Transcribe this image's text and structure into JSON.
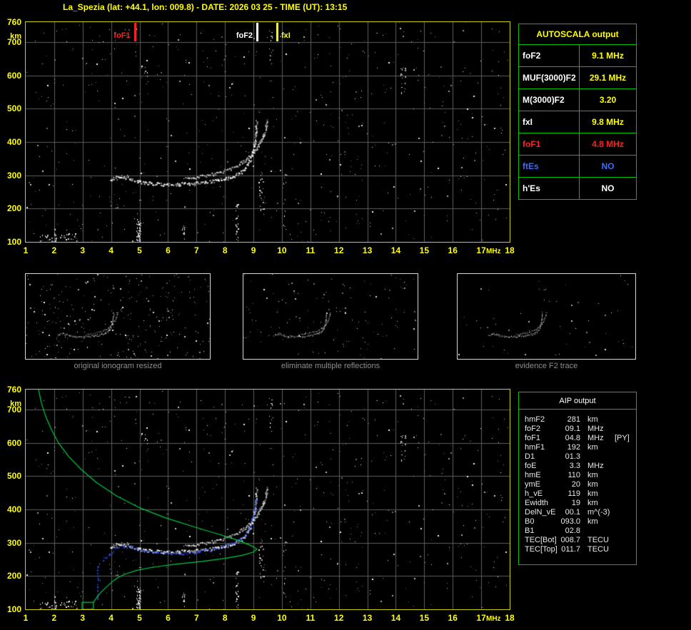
{
  "title": "La_Spezia (lat: +44.1, lon: 009.8) - DATE: 2026 03 25 - TIME (UT): 13:15",
  "colors": {
    "accent_yellow": "#ffff00",
    "plot_border": "#d0d000",
    "table_border": "#00c000",
    "grid": "#5c5c5c",
    "trace_white": "#ffffff",
    "profile_green": "#00cc44",
    "restored_blue": "#3355ff",
    "marker_red": "#ff0000",
    "caption_gray": "#8e8e8e"
  },
  "ionogram": {
    "x_unit": "MHz",
    "y_unit": "km",
    "f_range": [
      1,
      18
    ],
    "h_range": [
      100,
      760
    ],
    "x_ticks": [
      1,
      2,
      3,
      4,
      5,
      6,
      7,
      8,
      9,
      10,
      11,
      12,
      13,
      14,
      15,
      16,
      17,
      18
    ],
    "y_ticks": [
      760,
      700,
      600,
      500,
      400,
      300,
      200,
      100
    ],
    "markers": [
      {
        "label": "foF1",
        "freq": 4.8,
        "color": "#ff2222",
        "side": "left"
      },
      {
        "label": "foF2",
        "freq": 9.1,
        "color": "#ffffff",
        "side": "left"
      },
      {
        "label": "fxI",
        "freq": 9.8,
        "color": "#ffff00",
        "side": "right"
      }
    ],
    "o_trace": [
      [
        3.95,
        287
      ],
      [
        4.2,
        294
      ],
      [
        4.45,
        297
      ],
      [
        4.7,
        291
      ],
      [
        5.0,
        281
      ],
      [
        5.4,
        276
      ],
      [
        5.9,
        274
      ],
      [
        6.4,
        275
      ],
      [
        6.9,
        277
      ],
      [
        7.3,
        280
      ],
      [
        7.7,
        285
      ],
      [
        8.0,
        291
      ],
      [
        8.3,
        300
      ],
      [
        8.55,
        312
      ],
      [
        8.72,
        326
      ],
      [
        8.85,
        343
      ],
      [
        8.95,
        366
      ],
      [
        9.02,
        396
      ],
      [
        9.07,
        430
      ],
      [
        9.1,
        462
      ]
    ],
    "x_trace": [
      [
        6.6,
        291
      ],
      [
        7.0,
        296
      ],
      [
        7.4,
        302
      ],
      [
        7.8,
        310
      ],
      [
        8.1,
        318
      ],
      [
        8.4,
        329
      ],
      [
        8.65,
        342
      ],
      [
        8.85,
        357
      ],
      [
        9.05,
        374
      ],
      [
        9.2,
        394
      ],
      [
        9.32,
        417
      ],
      [
        9.42,
        444
      ],
      [
        9.48,
        466
      ]
    ]
  },
  "autoscala": {
    "title": "AUTOSCALA output",
    "rows": [
      {
        "param": "foF2",
        "value": "9.1 MHz",
        "param_color": "#ffffff",
        "value_color": "#ffff00"
      },
      {
        "param": "MUF(3000)F2",
        "value": "29.1 MHz",
        "param_color": "#ffffff",
        "value_color": "#ffff00"
      },
      {
        "param": "M(3000)F2",
        "value": "3.20",
        "param_color": "#ffffff",
        "value_color": "#ffff00"
      },
      {
        "param": "fxI",
        "value": "9.8 MHz",
        "param_color": "#ffffff",
        "value_color": "#ffff00"
      },
      {
        "param": "foF1",
        "value": "4.8 MHz",
        "param_color": "#ff2222",
        "value_color": "#ff2222"
      },
      {
        "param": "ftEs",
        "value": "NO",
        "param_color": "#3d6bff",
        "value_color": "#3d6bff"
      },
      {
        "param": "h'Es",
        "value": "NO",
        "param_color": "#ffffff",
        "value_color": "#ffffff"
      }
    ]
  },
  "thumbnails": [
    {
      "caption": "original ionogram resized"
    },
    {
      "caption": "eliminate multiple reflections"
    },
    {
      "caption": "evidence F2 trace"
    }
  ],
  "profile": {
    "topside": [
      [
        1.45,
        760
      ],
      [
        1.55,
        720
      ],
      [
        1.7,
        680
      ],
      [
        1.9,
        640
      ],
      [
        2.15,
        600
      ],
      [
        2.5,
        560
      ],
      [
        2.95,
        520
      ],
      [
        3.5,
        480
      ],
      [
        4.2,
        440
      ],
      [
        5.0,
        405
      ],
      [
        5.9,
        375
      ],
      [
        6.9,
        348
      ],
      [
        7.8,
        325
      ],
      [
        8.5,
        306
      ],
      [
        8.9,
        292
      ],
      [
        9.08,
        283
      ],
      [
        9.12,
        281
      ]
    ],
    "bottomside": [
      [
        9.12,
        281
      ],
      [
        9.0,
        272
      ],
      [
        8.6,
        262
      ],
      [
        8.0,
        253
      ],
      [
        7.2,
        244
      ],
      [
        6.3,
        236
      ],
      [
        5.5,
        227
      ],
      [
        4.9,
        217
      ],
      [
        4.5,
        206
      ],
      [
        4.25,
        196
      ],
      [
        4.1,
        187
      ],
      [
        3.9,
        172
      ],
      [
        3.7,
        156
      ],
      [
        3.55,
        142
      ],
      [
        3.45,
        130
      ],
      [
        3.38,
        121
      ]
    ],
    "e_box": [
      2.98,
      3.38,
      100,
      121
    ],
    "restored_trace": [
      [
        3.7,
        250
      ],
      [
        3.9,
        265
      ],
      [
        4.15,
        285
      ],
      [
        4.4,
        292
      ],
      [
        4.7,
        287
      ],
      [
        5.1,
        277
      ],
      [
        5.6,
        271
      ],
      [
        6.1,
        269
      ],
      [
        6.6,
        271
      ],
      [
        7.1,
        275
      ],
      [
        7.5,
        280
      ],
      [
        7.9,
        288
      ],
      [
        8.2,
        297
      ],
      [
        8.5,
        310
      ],
      [
        8.7,
        325
      ],
      [
        8.85,
        345
      ],
      [
        8.95,
        370
      ],
      [
        9.03,
        400
      ],
      [
        9.08,
        432
      ]
    ],
    "restored_spike": [
      [
        3.52,
        233
      ],
      [
        3.52,
        132
      ]
    ]
  },
  "aip": {
    "title": "AIP output",
    "rows": [
      {
        "param": "hmF2",
        "value": "281",
        "unit": "km",
        "note": ""
      },
      {
        "param": "foF2",
        "value": "09.1",
        "unit": "MHz",
        "note": ""
      },
      {
        "param": "foF1",
        "value": "04.8",
        "unit": "MHz",
        "note": "[PY]"
      },
      {
        "param": "hmF1",
        "value": "192",
        "unit": "km",
        "note": ""
      },
      {
        "param": "D1",
        "value": "01.3",
        "unit": "",
        "note": ""
      },
      {
        "param": "foE",
        "value": "3.3",
        "unit": "MHz",
        "note": ""
      },
      {
        "param": "hmE",
        "value": "110",
        "unit": "km",
        "note": ""
      },
      {
        "param": "ymE",
        "value": "20",
        "unit": "km",
        "note": ""
      },
      {
        "param": "h_vE",
        "value": "119",
        "unit": "km",
        "note": ""
      },
      {
        "param": "Ewidth",
        "value": "19",
        "unit": "km",
        "note": ""
      },
      {
        "param": "DelN_vE",
        "value": "00.1",
        "unit": "m^(-3)",
        "note": ""
      },
      {
        "param": "B0",
        "value": "093.0",
        "unit": "km",
        "note": ""
      },
      {
        "param": "B1",
        "value": "02.8",
        "unit": "",
        "note": ""
      },
      {
        "param": "TEC[Bot]",
        "value": "008.7",
        "unit": "TECU",
        "note": ""
      },
      {
        "param": "TEC[Top]",
        "value": "011.7",
        "unit": "TECU",
        "note": ""
      }
    ]
  }
}
